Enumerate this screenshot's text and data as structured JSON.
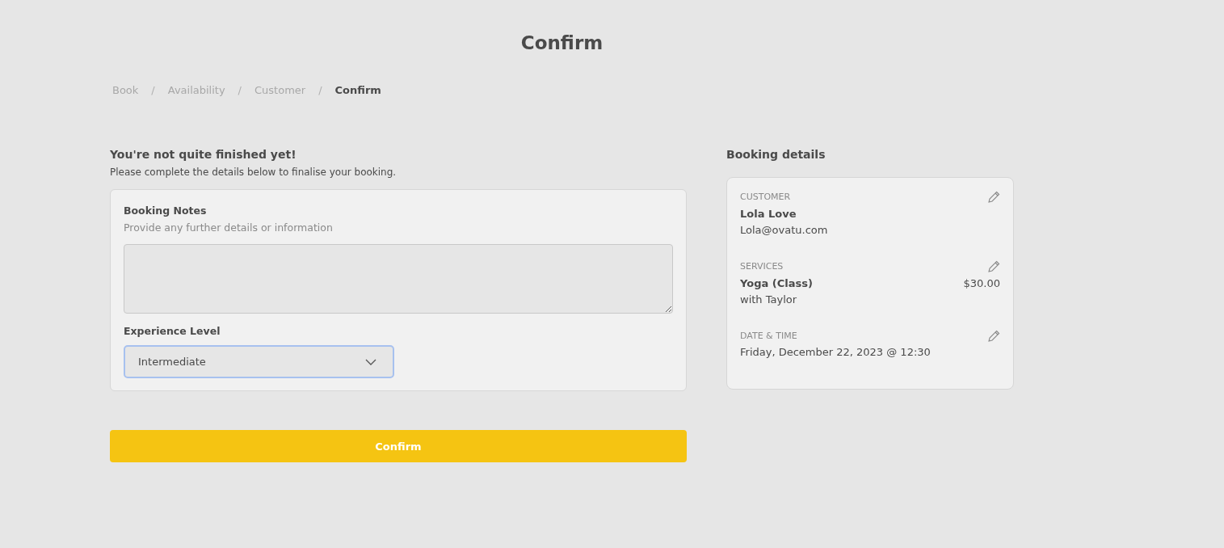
{
  "page_title": "Confirm",
  "breadcrumb": [
    {
      "label": "Book",
      "selected": false
    },
    {
      "label": "Availability",
      "selected": false
    },
    {
      "label": "Customer",
      "selected": false
    },
    {
      "label": "Confirm",
      "selected": true
    }
  ],
  "breadcrumb_separator": "/",
  "form": {
    "heading": "You're not quite finished yet!",
    "intro": "Please complete the details below to finalise your booking.",
    "notes": {
      "label": "Booking Notes",
      "hint": "Provide any further details or information"
    },
    "experience": {
      "label": "Experience Level",
      "value": "Intermediate",
      "focused": true
    }
  },
  "confirm_button": "Confirm",
  "booking_details": {
    "heading": "Booking details",
    "sections": [
      {
        "label": "CUSTOMER",
        "name": "Lola Love",
        "detail": "Lola@ovatu.com"
      },
      {
        "label": "SERVICES",
        "name": "Yoga (Class)",
        "price": "$30.00",
        "detail": "with Taylor"
      },
      {
        "label": "DATE & TIME",
        "detail": "Friday, December 22, 2023 @ 12:30"
      }
    ]
  }
}
